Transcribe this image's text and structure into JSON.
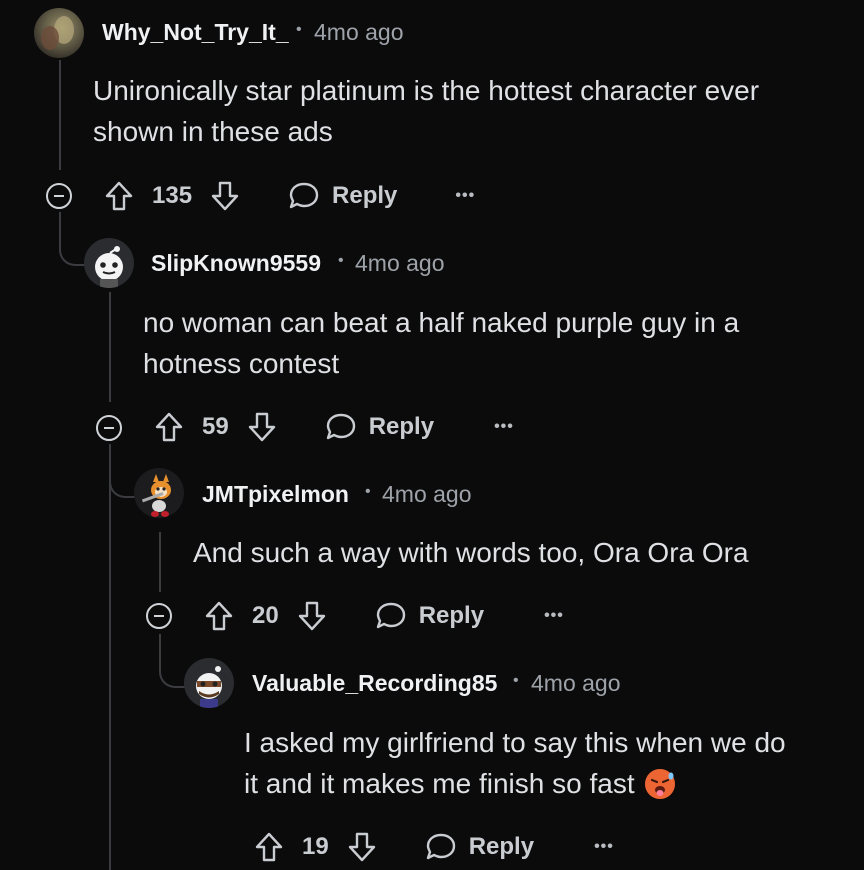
{
  "comments": [
    {
      "username": "Why_Not_Try_It_",
      "time": "4mo ago",
      "body_lines": [
        "Unironically star platinum is the hottest character ever",
        "shown in these ads"
      ],
      "votes": "135",
      "reply": "Reply"
    },
    {
      "username": "SlipKnown9559",
      "time": "4mo ago",
      "body_lines": [
        "no woman can beat a half naked purple guy in a",
        "hotness contest"
      ],
      "votes": "59",
      "reply": "Reply"
    },
    {
      "username": "JMTpixelmon",
      "time": "4mo ago",
      "body_lines": [
        "And such a way with words too, Ora Ora Ora"
      ],
      "votes": "20",
      "reply": "Reply"
    },
    {
      "username": "Valuable_Recording85",
      "time": "4mo ago",
      "body_lines": [
        "I asked my girlfriend to say this when we do",
        "it and it makes me finish so fast"
      ],
      "emoji": "hot-face-emoji",
      "votes": "19",
      "reply": "Reply"
    }
  ],
  "separator": "•",
  "more": "•••",
  "colors": {
    "background": "#0b0b0c",
    "text": "#dfe1e4",
    "muted": "#9ea3a9",
    "thread": "#3a3c40"
  }
}
